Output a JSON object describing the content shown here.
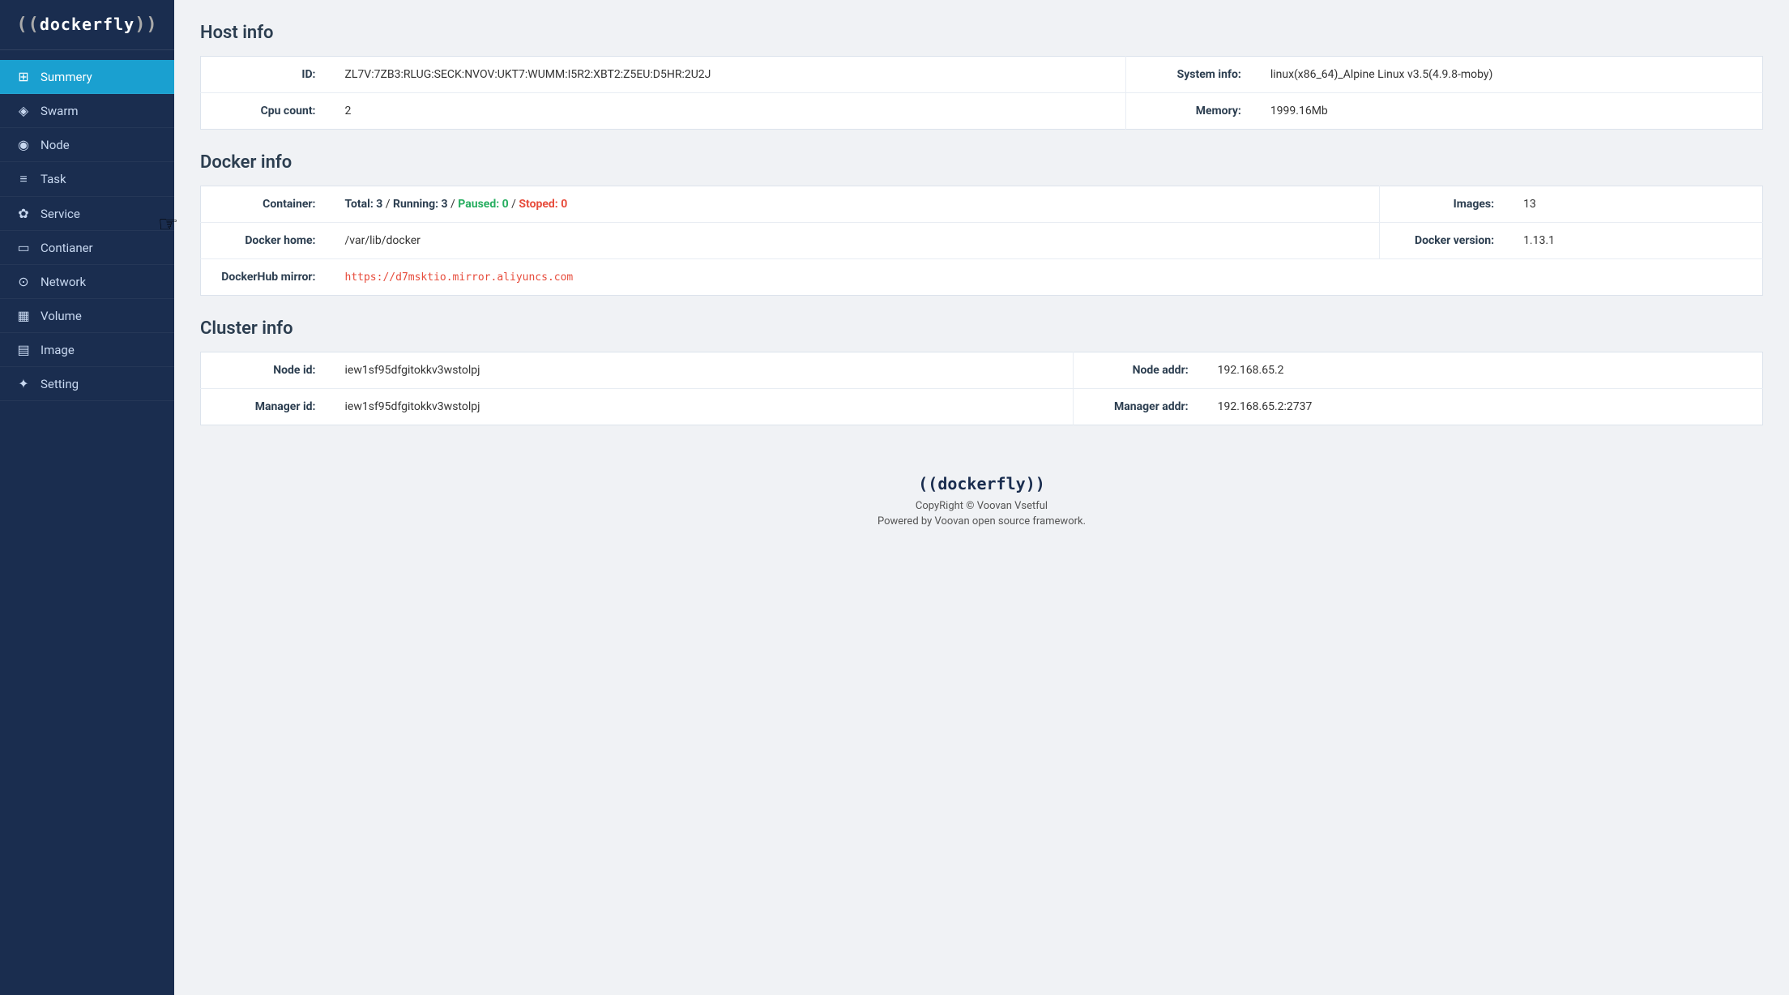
{
  "sidebar": {
    "logo": "((dockerfly))",
    "items": [
      {
        "id": "summery",
        "label": "Summery",
        "icon": "⊞",
        "active": true
      },
      {
        "id": "swarm",
        "label": "Swarm",
        "icon": "◈",
        "active": false
      },
      {
        "id": "node",
        "label": "Node",
        "icon": "◉",
        "active": false
      },
      {
        "id": "task",
        "label": "Task",
        "icon": "≡",
        "active": false
      },
      {
        "id": "service",
        "label": "Service",
        "icon": "✿",
        "active": false
      },
      {
        "id": "container",
        "label": "Contianer",
        "icon": "▭",
        "active": false
      },
      {
        "id": "network",
        "label": "Network",
        "icon": "⊙",
        "active": false
      },
      {
        "id": "volume",
        "label": "Volume",
        "icon": "▦",
        "active": false
      },
      {
        "id": "image",
        "label": "Image",
        "icon": "▤",
        "active": false
      },
      {
        "id": "setting",
        "label": "Setting",
        "icon": "✦",
        "active": false
      }
    ]
  },
  "host_info": {
    "title": "Host info",
    "id_label": "ID:",
    "id_value": "ZL7V:7ZB3:RLUG:SECK:NVOV:UKT7:WUMM:I5R2:XBT2:Z5EU:D5HR:2U2J",
    "system_info_label": "System info:",
    "system_info_value": "linux(x86_64)_Alpine Linux v3.5(4.9.8-moby)",
    "cpu_count_label": "Cpu count:",
    "cpu_count_value": "2",
    "memory_label": "Memory:",
    "memory_value": "1999.16Mb"
  },
  "docker_info": {
    "title": "Docker info",
    "container_label": "Container:",
    "container_total": "Total: 3",
    "container_running": "Running: 3",
    "container_paused": "Paused: 0",
    "container_stopped": "Stoped: 0",
    "images_label": "Images:",
    "images_value": "13",
    "docker_home_label": "Docker home:",
    "docker_home_value": "/var/lib/docker",
    "docker_version_label": "Docker version:",
    "docker_version_value": "1.13.1",
    "dockerhub_mirror_label": "DockerHub mirror:",
    "dockerhub_mirror_value": "https://d7msktio.mirror.aliyuncs.com"
  },
  "cluster_info": {
    "title": "Cluster info",
    "node_id_label": "Node id:",
    "node_id_value": "iew1sf95dfgitokkv3wstolpj",
    "node_addr_label": "Node addr:",
    "node_addr_value": "192.168.65.2",
    "manager_id_label": "Manager id:",
    "manager_id_value": "iew1sf95dfgitokkv3wstolpj",
    "manager_addr_label": "Manager addr:",
    "manager_addr_value": "192.168.65.2:2737"
  },
  "footer": {
    "logo": "((dockerfly))",
    "copyright": "CopyRight © Voovan Vsetful",
    "powered": "Powered by Voovan open source framework."
  }
}
